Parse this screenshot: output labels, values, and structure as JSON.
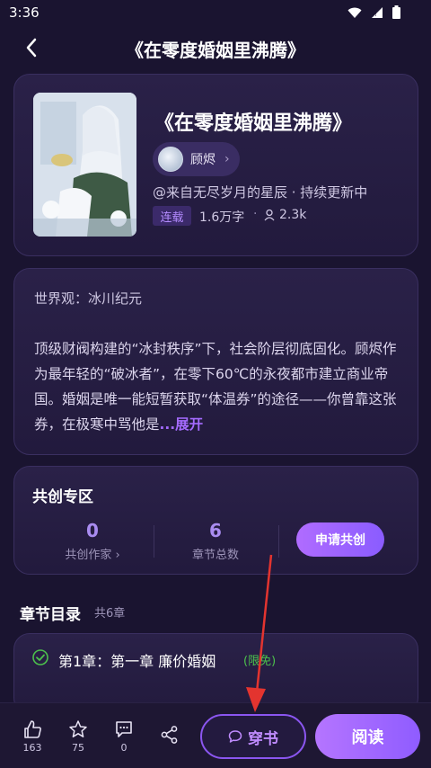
{
  "status_bar": {
    "time": "3:36"
  },
  "header": {
    "title": "《在零度婚姻里沸腾》"
  },
  "book": {
    "title": "《在零度婚姻里沸腾》",
    "author": "顾烬",
    "source": "@来自无尽岁月的星辰 · 持续更新中",
    "status_tag": "连载",
    "word_count": "1.6万字",
    "separator": "·",
    "readers": "2.3k"
  },
  "description": {
    "worldview": "世界观：冰川纪元",
    "text": "顶级财阀构建的“冰封秩序”下，社会阶层彻底固化。顾烬作为最年轻的“破冰者”，在零下60℃的永夜都市建立商业帝国。婚姻是唯一能短暂获取“体温券”的途径——你曾靠这张券，在极寒中骂他是",
    "expand": "...展开"
  },
  "co_create": {
    "title": "共创专区",
    "writers_count": "0",
    "writers_label": "共创作家 ›",
    "chapters_count": "6",
    "chapters_label": "章节总数",
    "apply_label": "申请共创"
  },
  "toc": {
    "title": "章节目录",
    "count": "共6章",
    "chapters": [
      {
        "title": "第1章：第一章 廉价婚姻",
        "tag": "(限免)"
      }
    ]
  },
  "bottom_bar": {
    "likes": "163",
    "stars": "75",
    "comments": "0",
    "chuan_label": "穿书",
    "read_label": "阅读"
  },
  "colors": {
    "accent": "#a56bff",
    "background": "#1a1430",
    "free": "#4cc14c"
  }
}
